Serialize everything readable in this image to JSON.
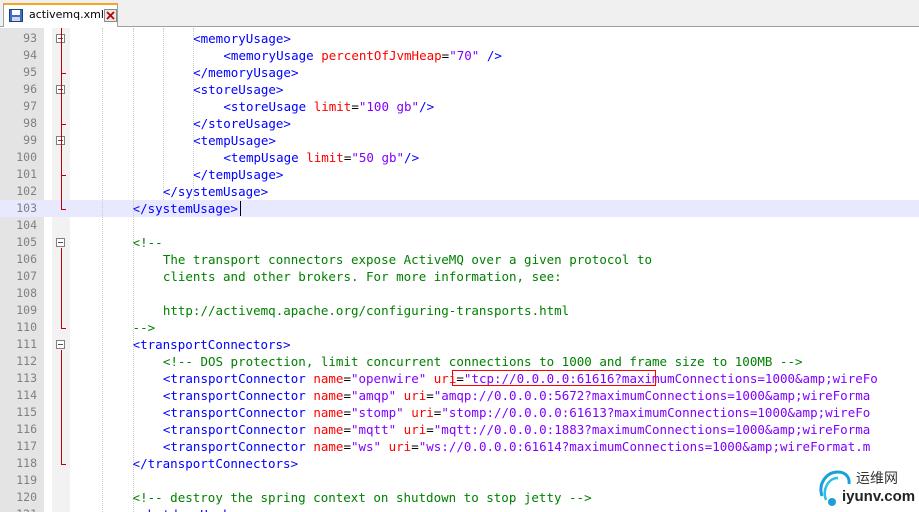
{
  "tab": {
    "label": "activemq.xml"
  },
  "watermark": {
    "cn": "运维网",
    "domain": "iyunv.com"
  },
  "lines": [
    {
      "num": "93",
      "seg": [
        {
          "c": "t",
          "x": "<memoryUsage>"
        }
      ]
    },
    {
      "num": "94",
      "seg": [
        {
          "c": "t",
          "x": "<memoryUsage "
        },
        {
          "c": "a",
          "x": "percentOfJvmHeap"
        },
        {
          "c": "p",
          "x": "="
        },
        {
          "c": "v",
          "x": "\"70\""
        },
        {
          "c": "t",
          "x": " />"
        }
      ]
    },
    {
      "num": "95",
      "seg": [
        {
          "c": "t",
          "x": "</memoryUsage>"
        }
      ]
    },
    {
      "num": "96",
      "seg": [
        {
          "c": "t",
          "x": "<storeUsage>"
        }
      ]
    },
    {
      "num": "97",
      "seg": [
        {
          "c": "t",
          "x": "<storeUsage "
        },
        {
          "c": "a",
          "x": "limit"
        },
        {
          "c": "p",
          "x": "="
        },
        {
          "c": "v",
          "x": "\"100 gb\""
        },
        {
          "c": "t",
          "x": "/>"
        }
      ]
    },
    {
      "num": "98",
      "seg": [
        {
          "c": "t",
          "x": "</storeUsage>"
        }
      ]
    },
    {
      "num": "99",
      "seg": [
        {
          "c": "t",
          "x": "<tempUsage>"
        }
      ]
    },
    {
      "num": "100",
      "seg": [
        {
          "c": "t",
          "x": "<tempUsage "
        },
        {
          "c": "a",
          "x": "limit"
        },
        {
          "c": "p",
          "x": "="
        },
        {
          "c": "v",
          "x": "\"50 gb\""
        },
        {
          "c": "t",
          "x": "/>"
        }
      ]
    },
    {
      "num": "101",
      "seg": [
        {
          "c": "t",
          "x": "</tempUsage>"
        }
      ]
    },
    {
      "num": "102",
      "seg": [
        {
          "c": "t",
          "x": "</systemUsage>"
        }
      ]
    },
    {
      "num": "103",
      "seg": [
        {
          "c": "t",
          "x": "</systemUsage>"
        }
      ]
    },
    {
      "num": "104",
      "seg": []
    },
    {
      "num": "105",
      "seg": [
        {
          "c": "c",
          "x": "<!--"
        }
      ]
    },
    {
      "num": "106",
      "seg": [
        {
          "c": "c",
          "x": "The transport connectors expose ActiveMQ over a given protocol to"
        }
      ]
    },
    {
      "num": "107",
      "seg": [
        {
          "c": "c",
          "x": "clients and other brokers. For more information, see:"
        }
      ]
    },
    {
      "num": "108",
      "seg": []
    },
    {
      "num": "109",
      "seg": [
        {
          "c": "c",
          "x": "http://activemq.apache.org/configuring-transports.html"
        }
      ]
    },
    {
      "num": "110",
      "seg": [
        {
          "c": "c",
          "x": "-->"
        }
      ]
    },
    {
      "num": "111",
      "seg": [
        {
          "c": "t",
          "x": "<transportConnectors>"
        }
      ]
    },
    {
      "num": "112",
      "seg": [
        {
          "c": "c",
          "x": "<!-- DOS protection, limit concurrent connections to 1000 and frame size to 100MB -->"
        }
      ]
    },
    {
      "num": "113",
      "seg": [
        {
          "c": "t",
          "x": "<transportConnector "
        },
        {
          "c": "a",
          "x": "name"
        },
        {
          "c": "p",
          "x": "="
        },
        {
          "c": "v",
          "x": "\"openwire\""
        },
        {
          "c": "p",
          "x": " "
        },
        {
          "c": "a",
          "x": "uri"
        },
        {
          "c": "p",
          "x": "="
        },
        {
          "c": "v",
          "x": "\"tcp://0.0.0.0:61616?maximumConnections=1000&amp;wireFo"
        }
      ]
    },
    {
      "num": "114",
      "seg": [
        {
          "c": "t",
          "x": "<transportConnector "
        },
        {
          "c": "a",
          "x": "name"
        },
        {
          "c": "p",
          "x": "="
        },
        {
          "c": "v",
          "x": "\"amqp\""
        },
        {
          "c": "p",
          "x": " "
        },
        {
          "c": "a",
          "x": "uri"
        },
        {
          "c": "p",
          "x": "="
        },
        {
          "c": "v",
          "x": "\"amqp://0.0.0.0:5672?maximumConnections=1000&amp;wireForma"
        }
      ]
    },
    {
      "num": "115",
      "seg": [
        {
          "c": "t",
          "x": "<transportConnector "
        },
        {
          "c": "a",
          "x": "name"
        },
        {
          "c": "p",
          "x": "="
        },
        {
          "c": "v",
          "x": "\"stomp\""
        },
        {
          "c": "p",
          "x": " "
        },
        {
          "c": "a",
          "x": "uri"
        },
        {
          "c": "p",
          "x": "="
        },
        {
          "c": "v",
          "x": "\"stomp://0.0.0.0:61613?maximumConnections=1000&amp;wireFo"
        }
      ]
    },
    {
      "num": "116",
      "seg": [
        {
          "c": "t",
          "x": "<transportConnector "
        },
        {
          "c": "a",
          "x": "name"
        },
        {
          "c": "p",
          "x": "="
        },
        {
          "c": "v",
          "x": "\"mqtt\""
        },
        {
          "c": "p",
          "x": " "
        },
        {
          "c": "a",
          "x": "uri"
        },
        {
          "c": "p",
          "x": "="
        },
        {
          "c": "v",
          "x": "\"mqtt://0.0.0.0:1883?maximumConnections=1000&amp;wireForma"
        }
      ]
    },
    {
      "num": "117",
      "seg": [
        {
          "c": "t",
          "x": "<transportConnector "
        },
        {
          "c": "a",
          "x": "name"
        },
        {
          "c": "p",
          "x": "="
        },
        {
          "c": "v",
          "x": "\"ws\""
        },
        {
          "c": "p",
          "x": " "
        },
        {
          "c": "a",
          "x": "uri"
        },
        {
          "c": "p",
          "x": "="
        },
        {
          "c": "v",
          "x": "\"ws://0.0.0.0:61614?maximumConnections=1000&amp;wireFormat.m"
        }
      ]
    },
    {
      "num": "118",
      "seg": [
        {
          "c": "t",
          "x": "</transportConnectors>"
        }
      ]
    },
    {
      "num": "119",
      "seg": []
    },
    {
      "num": "120",
      "seg": [
        {
          "c": "c",
          "x": "<!-- destroy the spring context on shutdown to stop jetty -->"
        }
      ]
    },
    {
      "num": "121",
      "seg": [
        {
          "c": "t",
          "x": "<shutdownHooks>"
        }
      ]
    }
  ]
}
